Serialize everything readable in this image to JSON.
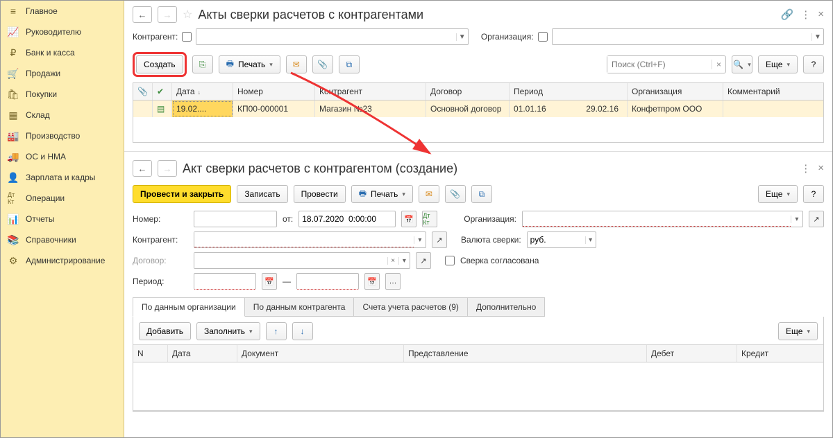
{
  "sidebar": {
    "items": [
      {
        "label": "Главное",
        "icon": "≡"
      },
      {
        "label": "Руководителю",
        "icon": "📈"
      },
      {
        "label": "Банк и касса",
        "icon": "₽"
      },
      {
        "label": "Продажи",
        "icon": "🛒"
      },
      {
        "label": "Покупки",
        "icon": "🛍"
      },
      {
        "label": "Склад",
        "icon": "▦"
      },
      {
        "label": "Производство",
        "icon": "🏭"
      },
      {
        "label": "ОС и НМА",
        "icon": "🚚"
      },
      {
        "label": "Зарплата и кадры",
        "icon": "👤"
      },
      {
        "label": "Операции",
        "icon": "Дт Кт"
      },
      {
        "label": "Отчеты",
        "icon": "📊"
      },
      {
        "label": "Справочники",
        "icon": "📚"
      },
      {
        "label": "Администрирование",
        "icon": "⚙"
      }
    ]
  },
  "upper": {
    "title": "Акты сверки расчетов с контрагентами",
    "filters": {
      "contr_label": "Контрагент:",
      "org_label": "Организация:"
    },
    "toolbar": {
      "create": "Создать",
      "print": "Печать",
      "search_placeholder": "Поиск (Ctrl+F)",
      "more": "Еще"
    },
    "grid": {
      "headers": {
        "date": "Дата",
        "num": "Номер",
        "cagent": "Контрагент",
        "contract": "Договор",
        "period": "Период",
        "org": "Организация",
        "comment": "Комментарий"
      },
      "row": {
        "date": "19.02....",
        "num": "КП00-000001",
        "cagent": "Магазин №23",
        "contract": "Основной договор",
        "period_from": "01.01.16",
        "period_to": "29.02.16",
        "org": "Конфетпром ООО",
        "comment": ""
      }
    }
  },
  "lower": {
    "title": "Акт сверки расчетов с контрагентом (создание)",
    "toolbar": {
      "post_close": "Провести и закрыть",
      "save": "Записать",
      "post": "Провести",
      "print": "Печать",
      "more": "Еще"
    },
    "form": {
      "num_label": "Номер:",
      "from_label": "от:",
      "date": "18.07.2020  0:00:00",
      "org_label": "Организация:",
      "contr_label": "Контрагент:",
      "currency_label": "Валюта сверки:",
      "currency": "руб.",
      "contract_label": "Договор:",
      "agreed_label": "Сверка согласована",
      "period_label": "Период:",
      "dash": "—"
    },
    "tabs": [
      "По данным организации",
      "По данным контрагента",
      "Счета учета расчетов (9)",
      "Дополнительно"
    ],
    "subtoolbar": {
      "add": "Добавить",
      "fill": "Заполнить",
      "more": "Еще"
    },
    "inner_headers": {
      "n": "N",
      "date": "Дата",
      "doc": "Документ",
      "rep": "Представление",
      "deb": "Дебет",
      "cred": "Кредит"
    }
  }
}
